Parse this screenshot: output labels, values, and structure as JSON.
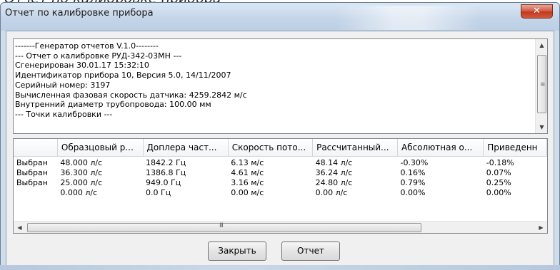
{
  "caption": "Отчет по калибровке прибора",
  "window": {
    "title": "Отчет по калибровке прибора",
    "close_glyph": "✕"
  },
  "report": {
    "lines": [
      "-------Генератор отчетов V.1.0--------",
      "--- Отчет о калибровке РУД-342-03МН ---",
      "Сгенерирован 30.01.17 15:32:10",
      "Идентификатор прибора 10, Версия 5.0, 14/11/2007",
      "Серийный номер: 3197",
      "Вычисленная фазовая скорость датчика: 4259.2842 м/с",
      "Внутренний диаметр трубопровода: 100.00 мм",
      "--- Точки калибровки ---"
    ]
  },
  "table": {
    "columns": [
      "",
      "Образцовый р...",
      "Доплера част...",
      "Скорость пото...",
      "Рассчитанный...",
      "Абсолютная о...",
      "Приведенн"
    ],
    "rows": [
      [
        "Выбран",
        "48.000 л/с",
        "1842.2 Гц",
        "6.13 м/с",
        "48.14 л/с",
        "-0.30%",
        "-0.18%"
      ],
      [
        "Выбран",
        "36.300 л/с",
        "1386.8 Гц",
        "4.61 м/с",
        "36.24 л/с",
        "0.16%",
        "0.07%"
      ],
      [
        "Выбран",
        "25.000 л/с",
        "949.0 Гц",
        "3.16 м/с",
        "24.80 л/с",
        "0.79%",
        "0.25%"
      ],
      [
        "",
        "0.000 л/с",
        "0.0 Гц",
        "0.00 м/с",
        "0.00 л/с",
        "0.00%",
        "0.00%"
      ]
    ]
  },
  "buttons": {
    "close_label": "Закрыть",
    "report_label": "Отчет"
  },
  "icons": {
    "scroll_up": "▲",
    "scroll_down": "▼",
    "scroll_left": "◀",
    "scroll_right": "▶",
    "grip_v": "≡",
    "grip_h": "III"
  }
}
